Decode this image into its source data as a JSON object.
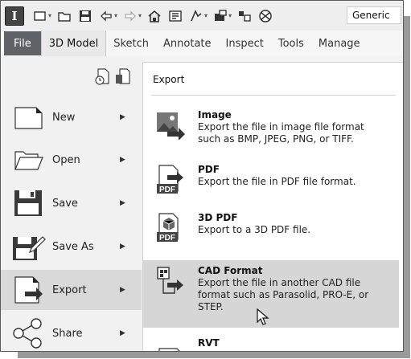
{
  "toolbar": {
    "app_letter": "I",
    "appearance_value": "Generic",
    "icons": [
      "new-icon",
      "open-icon",
      "save-icon",
      "undo-icon",
      "redo-icon",
      "home-icon",
      "project-icon",
      "update-icon",
      "measure-icon",
      "component-icon",
      "material-icon"
    ]
  },
  "ribbon": {
    "tabs": [
      "File",
      "3D Model",
      "Sketch",
      "Annotate",
      "Inspect",
      "Tools",
      "Manage"
    ],
    "active_tab": "3D Model"
  },
  "file_menu": {
    "items": [
      {
        "label": "New",
        "icon": "new-document-icon"
      },
      {
        "label": "Open",
        "icon": "open-folder-icon"
      },
      {
        "label": "Save",
        "icon": "floppy-disk-icon"
      },
      {
        "label": "Save As",
        "icon": "save-as-icon"
      },
      {
        "label": "Export",
        "icon": "export-icon"
      },
      {
        "label": "Share",
        "icon": "share-icon"
      }
    ],
    "selected": "Export"
  },
  "export_panel": {
    "title": "Export",
    "options": [
      {
        "title": "Image",
        "description": "Export the file in image file format such as BMP, JPEG, PNG, or TIFF.",
        "icon": "image-export-icon"
      },
      {
        "title": "PDF",
        "description": "Export the file in PDF file format.",
        "icon": "pdf-icon",
        "badge": "PDF"
      },
      {
        "title": "3D PDF",
        "description": "Export to a 3D PDF file.",
        "icon": "3d-pdf-icon",
        "badge": "PDF"
      },
      {
        "title": "CAD Format",
        "description": "Export the file in another CAD file format such as Parasolid, PRO-E, or STEP.",
        "icon": "cad-format-icon"
      },
      {
        "title": "RVT",
        "description": "",
        "icon": "rvt-icon"
      }
    ],
    "highlighted": "CAD Format"
  },
  "colors": {
    "file_tab": "#5f6368",
    "highlight": "#d6d6d6",
    "menu_selected": "#d9d9d9"
  }
}
